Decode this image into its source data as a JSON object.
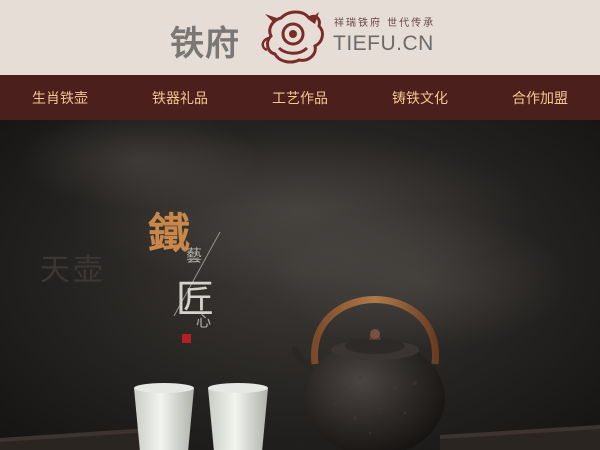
{
  "header": {
    "brand_cn": "铁府",
    "slogan": "祥瑞铁府 世代传承",
    "brand_en": "TIEFU.CN",
    "logo_icon": "dragon-logo-icon"
  },
  "nav": {
    "items": [
      {
        "label": "生肖铁壶"
      },
      {
        "label": "铁器礼品"
      },
      {
        "label": "工艺作品"
      },
      {
        "label": "铸铁文化"
      },
      {
        "label": "合作加盟"
      }
    ]
  },
  "hero": {
    "calligraphy_main": "鐵",
    "calligraphy_sub1": "藝",
    "calligraphy_sub2": "匠",
    "calligraphy_sub3": "心",
    "background_text": "天壶",
    "colors": {
      "accent": "#c9884a",
      "nav_bg": "#4a1f1c",
      "nav_text": "#f0c890",
      "header_bg": "#e5ddd6"
    }
  }
}
